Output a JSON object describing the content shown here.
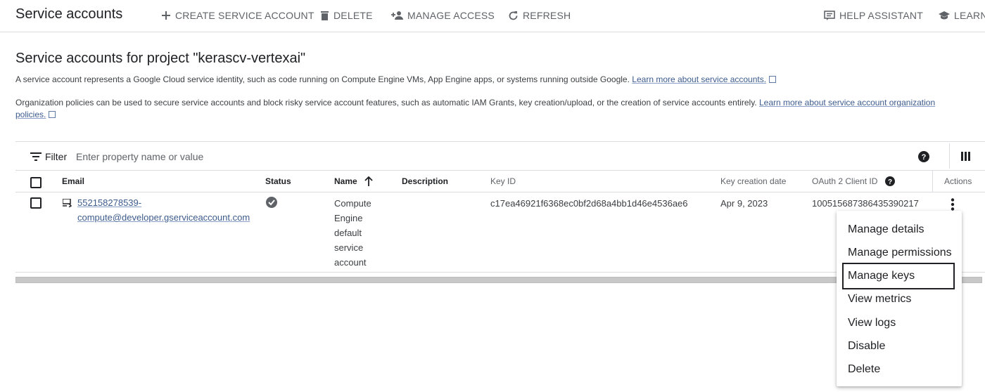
{
  "header": {
    "title": "Service accounts",
    "actions": {
      "create": "CREATE SERVICE ACCOUNT",
      "delete": "DELETE",
      "manage_access": "MANAGE ACCESS",
      "refresh": "REFRESH",
      "help": "HELP ASSISTANT",
      "learn": "LEARN"
    }
  },
  "section": {
    "title": "Service accounts for project \"kerascv-vertexai\"",
    "desc1": "A service account represents a Google Cloud service identity, such as code running on Compute Engine VMs, App Engine apps, or systems running outside Google.",
    "desc1_link": "Learn more about service accounts.",
    "desc2": "Organization policies can be used to secure service accounts and block risky service account features, such as automatic IAM Grants, key creation/upload, or the creation of service accounts entirely.",
    "desc2_link_a": "Learn more about service account organization",
    "desc2_link_b": "policies."
  },
  "filter": {
    "label": "Filter",
    "placeholder": "Enter property name or value"
  },
  "table": {
    "columns": {
      "email": "Email",
      "status": "Status",
      "name": "Name",
      "description": "Description",
      "key_id": "Key ID",
      "key_date": "Key creation date",
      "oauth": "OAuth 2 Client ID",
      "actions": "Actions"
    },
    "row": {
      "email_line1": "552158278539-",
      "email_line2": "compute@developer.gserviceaccount.com",
      "name_lines": [
        "Compute",
        "Engine",
        "default",
        "service",
        "account"
      ],
      "description": "",
      "key_id": "c17ea46921f6368ec0bf2d68a4bb1d46e4536ae6",
      "key_date": "Apr 9, 2023",
      "oauth_id": "100515687386435390217"
    }
  },
  "menu": {
    "items": [
      "Manage details",
      "Manage permissions",
      "Manage keys",
      "View metrics",
      "View logs",
      "Disable",
      "Delete"
    ]
  },
  "colors": {
    "link": "#3c5b8c",
    "icon": "#5f6368",
    "border": "#dadce0"
  }
}
